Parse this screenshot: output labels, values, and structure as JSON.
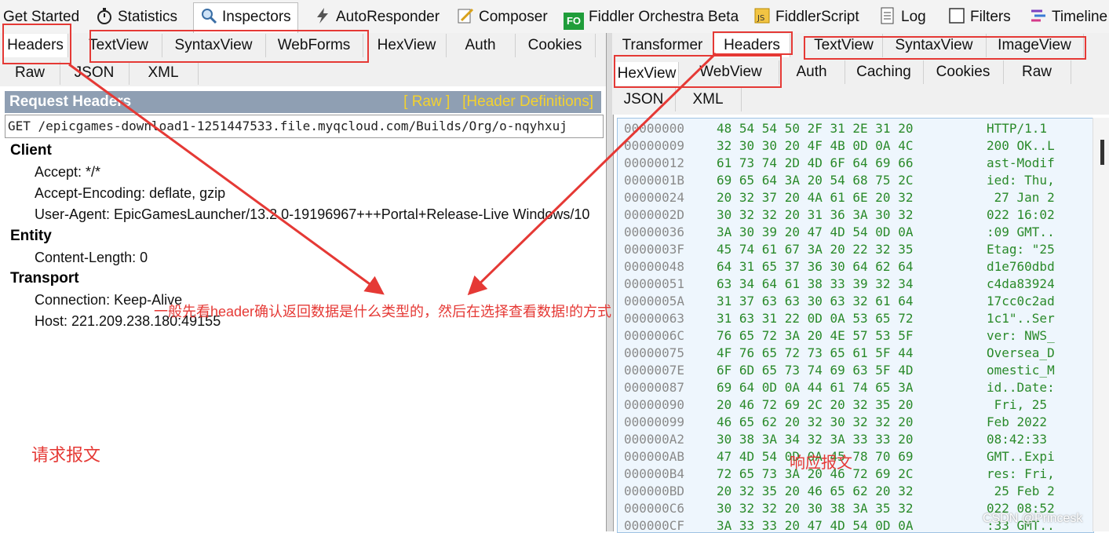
{
  "top_tabs": [
    {
      "label": "Get Started",
      "icon": "none"
    },
    {
      "label": "Statistics",
      "icon": "stopwatch-icon"
    },
    {
      "label": "Inspectors",
      "icon": "magnifier-icon"
    },
    {
      "label": "AutoResponder",
      "icon": "lightning-icon"
    },
    {
      "label": "Composer",
      "icon": "pencil-icon"
    },
    {
      "label": "Fiddler Orchestra Beta",
      "icon": "fo-icon",
      "icon_text": "FO"
    },
    {
      "label": "FiddlerScript",
      "icon": "script-icon"
    },
    {
      "label": "Log",
      "icon": "log-icon"
    },
    {
      "label": "Filters",
      "icon": "checkbox-icon"
    },
    {
      "label": "Timeline",
      "icon": "timeline-icon"
    }
  ],
  "request": {
    "tabs_row1": [
      "Headers",
      "TextView",
      "SyntaxView",
      "WebForms",
      "HexView",
      "Auth",
      "Cookies"
    ],
    "tabs_row2": [
      "Raw",
      "JSON",
      "XML"
    ],
    "title": "Request Headers",
    "link_raw": "[ Raw ]",
    "link_defs": "[Header Definitions]",
    "request_line": "GET /epicgames-download1-1251447533.file.myqcloud.com/Builds/Org/o-nqyhxuj",
    "groups": [
      {
        "name": "Client",
        "headers": [
          "Accept: */*",
          "Accept-Encoding: deflate, gzip",
          "User-Agent: EpicGamesLauncher/13.2.0-19196967+++Portal+Release-Live Windows/10"
        ]
      },
      {
        "name": "Entity",
        "headers": [
          "Content-Length: 0"
        ]
      },
      {
        "name": "Transport",
        "headers": [
          "Connection: Keep-Alive",
          "Host: 221.209.238.180:49155"
        ]
      }
    ]
  },
  "response": {
    "tabs_row1": [
      "Transformer",
      "Headers",
      "TextView",
      "SyntaxView",
      "ImageView"
    ],
    "tabs_row2": [
      "HexView",
      "WebView",
      "Auth",
      "Caching",
      "Cookies",
      "Raw"
    ],
    "tabs_row3": [
      "JSON",
      "XML"
    ],
    "hex_rows": [
      {
        "offset": "00000000",
        "bytes": "48 54 54 50 2F 31 2E 31 20",
        "ascii": "HTTP/1.1 "
      },
      {
        "offset": "00000009",
        "bytes": "32 30 30 20 4F 4B 0D 0A 4C",
        "ascii": "200 OK..L"
      },
      {
        "offset": "00000012",
        "bytes": "61 73 74 2D 4D 6F 64 69 66",
        "ascii": "ast-Modif"
      },
      {
        "offset": "0000001B",
        "bytes": "69 65 64 3A 20 54 68 75 2C",
        "ascii": "ied: Thu,"
      },
      {
        "offset": "00000024",
        "bytes": "20 32 37 20 4A 61 6E 20 32",
        "ascii": " 27 Jan 2"
      },
      {
        "offset": "0000002D",
        "bytes": "30 32 32 20 31 36 3A 30 32",
        "ascii": "022 16:02"
      },
      {
        "offset": "00000036",
        "bytes": "3A 30 39 20 47 4D 54 0D 0A",
        "ascii": ":09 GMT.."
      },
      {
        "offset": "0000003F",
        "bytes": "45 74 61 67 3A 20 22 32 35",
        "ascii": "Etag: \"25"
      },
      {
        "offset": "00000048",
        "bytes": "64 31 65 37 36 30 64 62 64",
        "ascii": "d1e760dbd"
      },
      {
        "offset": "00000051",
        "bytes": "63 34 64 61 38 33 39 32 34",
        "ascii": "c4da83924"
      },
      {
        "offset": "0000005A",
        "bytes": "31 37 63 63 30 63 32 61 64",
        "ascii": "17cc0c2ad"
      },
      {
        "offset": "00000063",
        "bytes": "31 63 31 22 0D 0A 53 65 72",
        "ascii": "1c1\"..Ser"
      },
      {
        "offset": "0000006C",
        "bytes": "76 65 72 3A 20 4E 57 53 5F",
        "ascii": "ver: NWS_"
      },
      {
        "offset": "00000075",
        "bytes": "4F 76 65 72 73 65 61 5F 44",
        "ascii": "Oversea_D"
      },
      {
        "offset": "0000007E",
        "bytes": "6F 6D 65 73 74 69 63 5F 4D",
        "ascii": "omestic_M"
      },
      {
        "offset": "00000087",
        "bytes": "69 64 0D 0A 44 61 74 65 3A",
        "ascii": "id..Date:"
      },
      {
        "offset": "00000090",
        "bytes": "20 46 72 69 2C 20 32 35 20",
        "ascii": " Fri, 25 "
      },
      {
        "offset": "00000099",
        "bytes": "46 65 62 20 32 30 32 32 20",
        "ascii": "Feb 2022 "
      },
      {
        "offset": "000000A2",
        "bytes": "30 38 3A 34 32 3A 33 33 20",
        "ascii": "08:42:33 "
      },
      {
        "offset": "000000AB",
        "bytes": "47 4D 54 0D 0A 45 78 70 69",
        "ascii": "GMT..Expi"
      },
      {
        "offset": "000000B4",
        "bytes": "72 65 73 3A 20 46 72 69 2C",
        "ascii": "res: Fri,"
      },
      {
        "offset": "000000BD",
        "bytes": "20 32 35 20 46 65 62 20 32",
        "ascii": " 25 Feb 2"
      },
      {
        "offset": "000000C6",
        "bytes": "30 32 32 20 30 38 3A 35 32",
        "ascii": "022 08:52"
      },
      {
        "offset": "000000CF",
        "bytes": "3A 33 33 20 47 4D 54 0D 0A",
        "ascii": ":33 GMT.."
      }
    ]
  },
  "annotations": {
    "center_note": "一般先看header确认返回数据是什么类型的，然后在选择查看数据!的方式",
    "request_label": "请求报文",
    "response_label": "响应报文",
    "color": "#e53935"
  },
  "watermark": "CSDN @Princesk",
  "colors": {
    "title_bar": "#8f9fb3",
    "title_links": "#f4d22e",
    "hex_text": "#2a8a2a",
    "hex_bg": "#eef6fd"
  }
}
